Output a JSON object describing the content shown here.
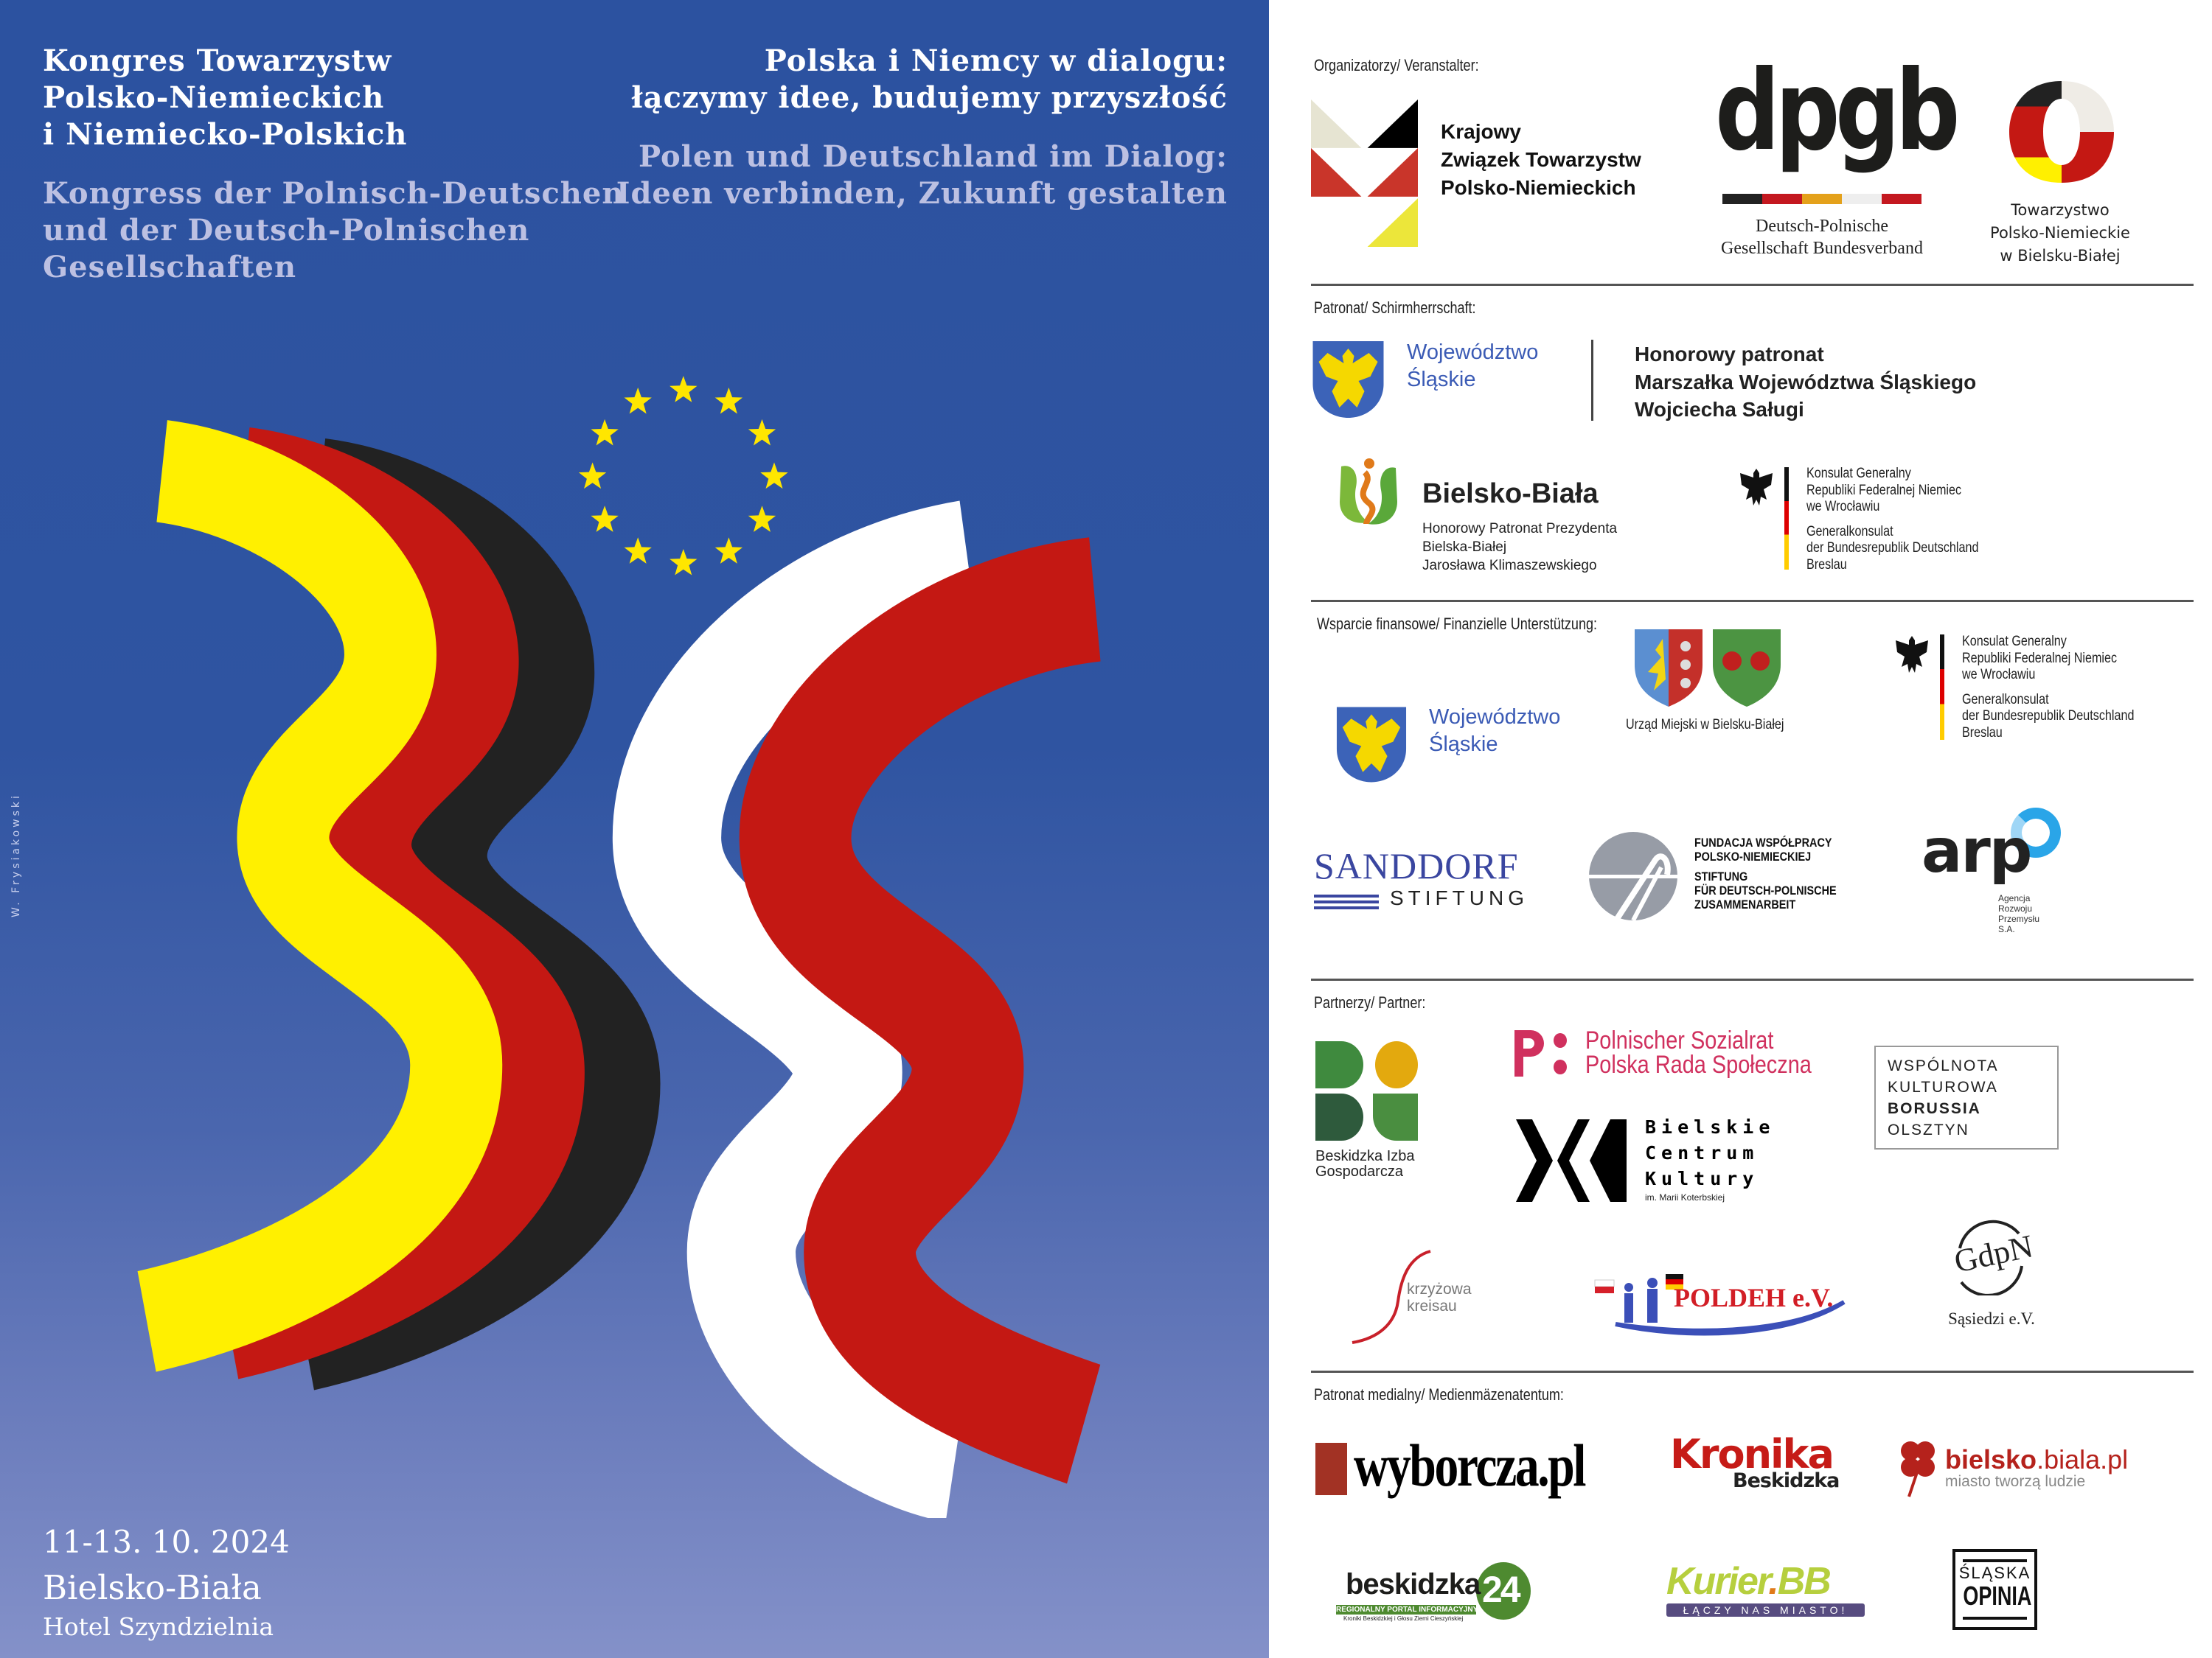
{
  "poster": {
    "title_pl": [
      "Kongres Towarzystw",
      "Polsko-Niemieckich",
      "i Niemiecko-Polskich"
    ],
    "title_de": [
      "Kongress der Polnisch-Deutschen",
      "und der Deutsch-Polnischen",
      "Gesellschaften"
    ],
    "motto_pl": [
      "Polska i Niemcy w dialogu:",
      "łączymy idee, budujemy przyszłość"
    ],
    "motto_de": [
      "Polen und Deutschland im Dialog:",
      "Ideen verbinden, Zukunft gestalten"
    ],
    "date": "11-13. 10. 2024",
    "city": "Bielsko-Biała",
    "venue": "Hotel Szyndzielnia",
    "signature": "W. Frysiakowski",
    "colors": {
      "yellow": "#fff000",
      "red": "#c41813",
      "black": "#222222",
      "white": "#ffffff",
      "star": "#ffe600",
      "background_top": "#2c52a0",
      "background_bottom": "#8491c9"
    }
  },
  "organizers": {
    "label": "Organizatorzy/ Veranstalter:",
    "kzt": [
      "Krajowy",
      "Związek Towarzystw",
      "Polsko-Niemieckich"
    ],
    "dpgb": {
      "logo": "dpgb",
      "lines": [
        "Deutsch-Polnische",
        "Gesellschaft Bundesverband"
      ]
    },
    "tpn": [
      "Towarzystwo",
      "Polsko-Niemieckie",
      "w Bielsku-Białej"
    ]
  },
  "patronage": {
    "label": "Patronat/ Schirmherrschaft:",
    "slaskie": [
      "Województwo",
      "Śląskie"
    ],
    "marshal": [
      "Honorowy patronat",
      "Marszałka Województwa Śląskiego",
      "Wojciecha Saługi"
    ],
    "bielsko": {
      "name": "Bielsko-Biała",
      "lines": [
        "Honorowy Patronat Prezydenta",
        "Bielska-Białej",
        "Jarosława Klimaszewskiego"
      ]
    },
    "consulate": {
      "pl": [
        "Konsulat Generalny",
        "Republiki Federalnej Niemiec",
        "we Wrocławiu"
      ],
      "de": [
        "Generalkonsulat",
        "der Bundesrepublik Deutschland",
        "Breslau"
      ]
    }
  },
  "funding": {
    "label": "Wsparcie finansowe/ Finanzielle Unterstützung:",
    "slaskie": [
      "Województwo",
      "Śląskie"
    ],
    "city_office": "Urząd Miejski w Bielsku-Białej",
    "consulate": {
      "pl": [
        "Konsulat Generalny",
        "Republiki Federalnej Niemiec",
        "we Wrocławiu"
      ],
      "de": [
        "Generalkonsulat",
        "der Bundesrepublik Deutschland",
        "Breslau"
      ]
    },
    "sanddorf": {
      "name": "SANDDORF",
      "sub": "STIFTUNG"
    },
    "fwpn": [
      "FUNDACJA WSPÓŁPRACY",
      "POLSKO-NIEMIECKIEJ",
      "STIFTUNG",
      "FÜR DEUTSCH-POLNISCHE",
      "ZUSAMMENARBEIT"
    ],
    "arp": {
      "name": "arp",
      "lines": [
        "Agencja",
        "Rozwoju",
        "Przemysłu",
        "S.A."
      ]
    }
  },
  "partners": {
    "label": "Partnerzy/ Partner:",
    "big": [
      "Beskidzka Izba",
      "Gospodarcza"
    ],
    "sozialrat": [
      "Polnischer Sozialrat",
      "Polska Rada Społeczna"
    ],
    "borussia": [
      "WSPÓLNOTA",
      "KULTUROWA",
      "BORUSSIA",
      "OLSZTYN"
    ],
    "bck": [
      "Bielskie",
      "Centrum",
      "Kultury",
      "im. Marii Koterbskiej"
    ],
    "krzyzowa": [
      "krzyżowa",
      "kreisau"
    ],
    "poldeh": "POLDEH e.V.",
    "sasiedzi": {
      "logo": "GdpN",
      "name": "Sąsiedzi e.V."
    }
  },
  "media": {
    "label": "Patronat medialny/ Medienmäzenatentum:",
    "wyborcza": "wyborcza.pl",
    "kronika": [
      "Kronika",
      "Beskidzka"
    ],
    "bielskobiala": {
      "name_a": "bielsko",
      "name_b": ".biala.pl",
      "tagline": "miasto tworzą ludzie"
    },
    "beskidzka24": {
      "name": "beskidzka",
      "num": "24",
      "sub": "REGIONALNY PORTAL INFORMACYJNY",
      "sub2": "Kroniki Beskidzkiej i Głosu Ziemi Cieszyńskiej"
    },
    "kurier": {
      "name": "Kurier",
      "dot": ".",
      "bb": "BB",
      "tagline": "ŁĄCZY NAS MIASTO!"
    },
    "opinia": [
      "ŚLĄSKA",
      "OPINIA"
    ]
  }
}
